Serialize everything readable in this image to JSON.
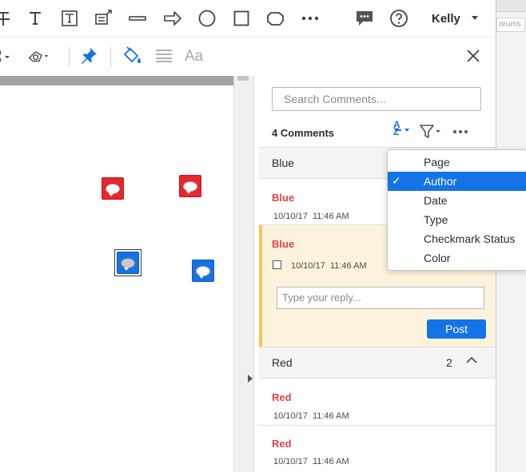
{
  "toolbar": {
    "icons": [
      "strikethrough-text-icon",
      "text-icon",
      "textbox-icon",
      "text-callout-icon",
      "line-icon",
      "arrow-icon",
      "oval-icon",
      "rectangle-icon",
      "cloud-icon",
      "more-icon",
      "comment-panel-icon",
      "help-icon"
    ],
    "user_name": "Kelly",
    "forums_fragment": "orums"
  },
  "toolbar2": {
    "font_label": "Aa"
  },
  "panel": {
    "search_placeholder": "Search Comments...",
    "count_label": "4 Comments",
    "sort_icon_text": "AZ",
    "groups": [
      {
        "label": "Blue",
        "comments": [
          {
            "author": "Blue",
            "date": "10/10/17",
            "time": "11:46 AM"
          },
          {
            "author": "Blue",
            "date": "10/10/17",
            "time": "11:46 AM"
          }
        ]
      },
      {
        "label": "Red",
        "count": "2",
        "comments": [
          {
            "author": "Red",
            "date": "10/10/17",
            "time": "11:46 AM"
          },
          {
            "author": "Red",
            "date": "10/10/17",
            "time": "11:46 AM"
          }
        ]
      }
    ],
    "reply_placeholder": "Type your reply...",
    "post_label": "Post"
  },
  "sort_menu": {
    "items": [
      {
        "label": "Page",
        "checked": false
      },
      {
        "label": "Author",
        "checked": true
      },
      {
        "label": "Date",
        "checked": false
      },
      {
        "label": "Type",
        "checked": false
      },
      {
        "label": "Checkmark Status",
        "checked": false
      },
      {
        "label": "Color",
        "checked": false
      }
    ],
    "check_glyph": "✓"
  },
  "colors": {
    "accent": "#1473e6",
    "red_author": "#e0424b",
    "sticky_red": "#e8262d",
    "sticky_blue": "#1473e6",
    "selected_comment_bg": "#fdf3dc",
    "selected_comment_bar": "#f5c657"
  }
}
